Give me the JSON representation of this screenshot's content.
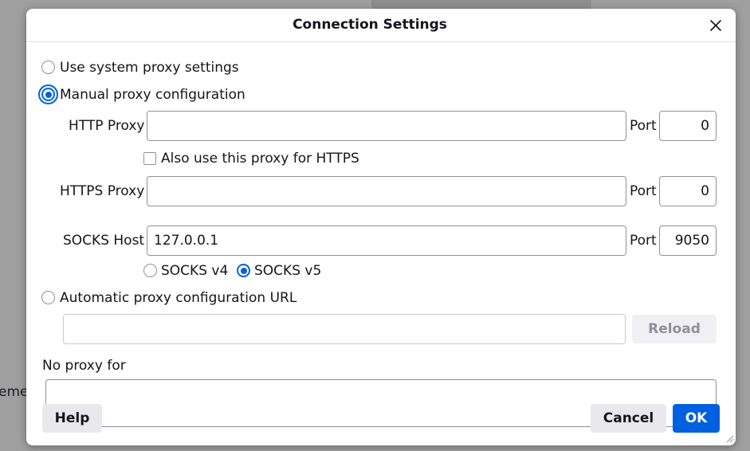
{
  "background": {
    "partial_text": "eme"
  },
  "dialog": {
    "title": "Connection Settings",
    "accent": "#0061e0",
    "options": {
      "system_proxy": "Use system proxy settings",
      "manual_proxy": "Manual proxy configuration",
      "auto_url": "Automatic proxy configuration URL"
    },
    "http": {
      "label": "HTTP Proxy",
      "value": "",
      "port_label": "Port",
      "port": "0"
    },
    "also_https": "Also use this proxy for HTTPS",
    "https": {
      "label": "HTTPS Proxy",
      "value": "",
      "port_label": "Port",
      "port": "0"
    },
    "socks": {
      "label": "SOCKS Host",
      "value": "127.0.0.1",
      "port_label": "Port",
      "port": "9050",
      "v4": "SOCKS v4",
      "v5": "SOCKS v5"
    },
    "auto_url_value": "",
    "reload": "Reload",
    "no_proxy_label": "No proxy for",
    "no_proxy_value": "",
    "help": "Help",
    "cancel": "Cancel",
    "ok": "OK"
  }
}
